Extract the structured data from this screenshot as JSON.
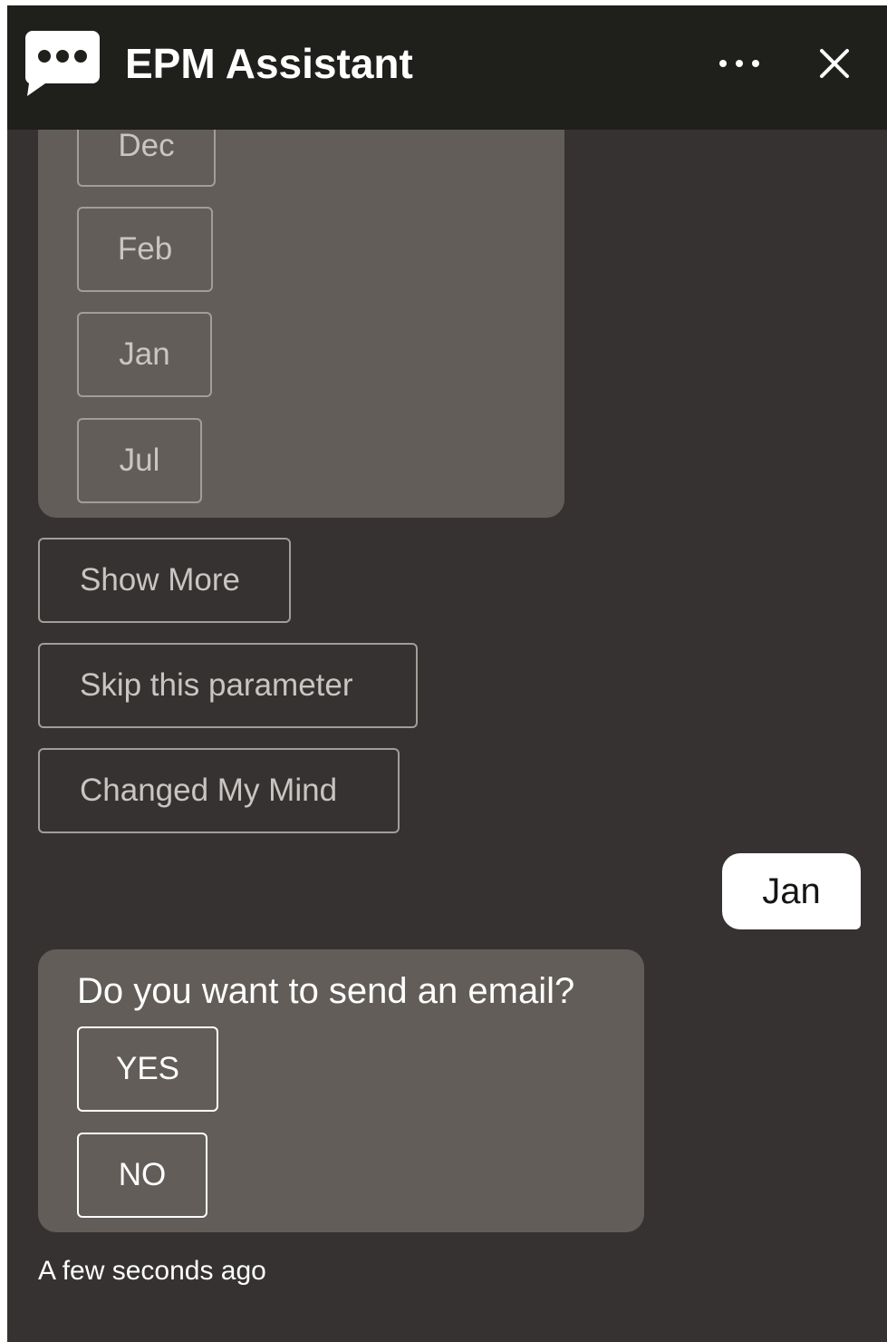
{
  "header": {
    "title": "EPM Assistant",
    "logo_icon": "chat-bubble-icon",
    "more_icon": "ellipsis-icon",
    "close_icon": "close-icon"
  },
  "month_options": [
    "Dec",
    "Feb",
    "Jan",
    "Jul"
  ],
  "actions": {
    "show_more": "Show More",
    "skip": "Skip this parameter",
    "changed_mind": "Changed My Mind"
  },
  "user_reply": "Jan",
  "email_prompt": {
    "question": "Do you want to send an email?",
    "yes": "YES",
    "no": "NO"
  },
  "timestamp": "A few seconds ago",
  "colors": {
    "header_bg": "#1f1f1c",
    "panel_bg": "#373232",
    "card_bg": "#625d58",
    "user_bubble_bg": "#ffffff"
  }
}
